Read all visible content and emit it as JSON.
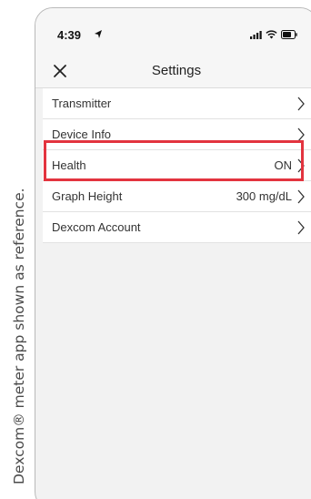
{
  "caption": "Dexcom® meter app shown as reference.",
  "status_bar": {
    "time": "4:39"
  },
  "nav": {
    "title": "Settings",
    "close_icon": "close-x-icon"
  },
  "settings": [
    {
      "label": "Transmitter",
      "value": ""
    },
    {
      "label": "Device Info",
      "value": ""
    },
    {
      "label": "Health",
      "value": "ON"
    },
    {
      "label": "Graph Height",
      "value": "300 mg/dL"
    },
    {
      "label": "Dexcom Account",
      "value": ""
    }
  ],
  "colors": {
    "highlight": "#e3343f",
    "background": "#f2f2f2"
  }
}
